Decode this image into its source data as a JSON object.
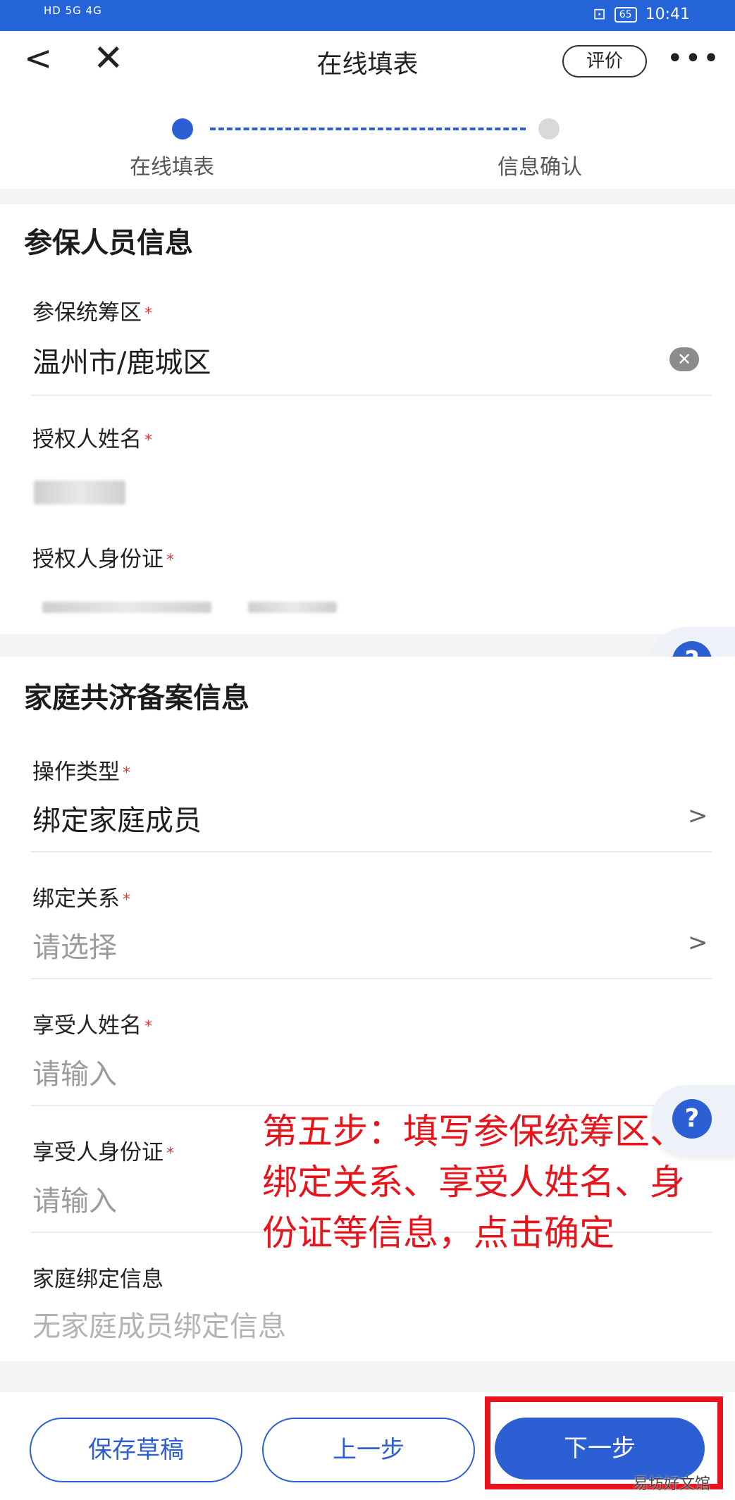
{
  "status_bar": {
    "left_text": "HD 5G 4G",
    "time": "10:41",
    "battery": "65"
  },
  "header": {
    "back": "<",
    "close": "✕",
    "title": "在线填表",
    "rate_button": "评价",
    "more": "•••"
  },
  "steps": [
    {
      "label": "在线填表",
      "active": true
    },
    {
      "label": "信息确认",
      "active": false
    }
  ],
  "section_insured": {
    "title": "参保人员信息",
    "fields": {
      "region": {
        "label": "参保统筹区",
        "value": "温州市/鹿城区"
      },
      "authorizer_name": {
        "label": "授权人姓名"
      },
      "authorizer_id": {
        "label": "授权人身份证"
      }
    }
  },
  "section_family": {
    "title": "家庭共济备案信息",
    "fields": {
      "operation_type": {
        "label": "操作类型",
        "value": "绑定家庭成员"
      },
      "binding_relation": {
        "label": "绑定关系",
        "placeholder": "请选择"
      },
      "beneficiary_name": {
        "label": "享受人姓名",
        "placeholder": "请输入"
      },
      "beneficiary_id": {
        "label": "享受人身份证",
        "placeholder": "请输入"
      },
      "family_binding_info": {
        "label": "家庭绑定信息",
        "value": "无家庭成员绑定信息"
      }
    }
  },
  "help_icon": "?",
  "chevron": ">",
  "required_mark": "*",
  "annotation": "第五步：填写参保统筹区、绑定关系、享受人姓名、身份证等信息，点击确定",
  "buttons": {
    "save_draft": "保存草稿",
    "previous": "上一步",
    "next": "下一步"
  },
  "watermark": "易坊好文馆",
  "colors": {
    "accent": "#2c5fd4",
    "status_bar": "#2463d8",
    "annotation_red": "#e8141b",
    "required": "#e53935"
  }
}
